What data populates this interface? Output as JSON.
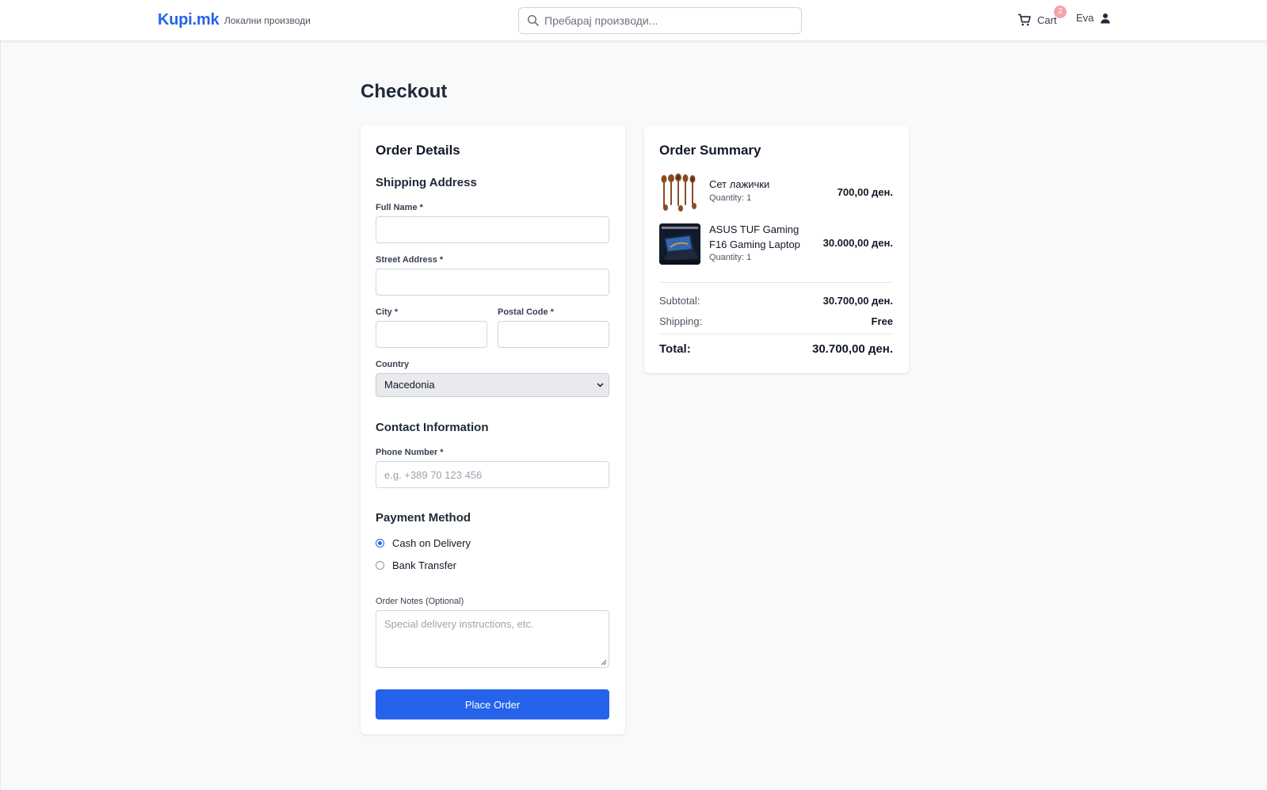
{
  "header": {
    "logo": "Kupi.mk",
    "tagline": "Локални производи",
    "search_placeholder": "Пребарај производи...",
    "cart_label": "Cart",
    "cart_count": "2",
    "user_name": "Eva"
  },
  "page": {
    "title": "Checkout"
  },
  "order_details": {
    "title": "Order Details",
    "shipping": {
      "title": "Shipping Address",
      "full_name_label": "Full Name *",
      "full_name_value": "",
      "street_label": "Street Address *",
      "street_value": "",
      "city_label": "City *",
      "city_value": "",
      "postal_label": "Postal Code *",
      "postal_value": "",
      "country_label": "Country",
      "country_value": "Macedonia"
    },
    "contact": {
      "title": "Contact Information",
      "phone_label": "Phone Number *",
      "phone_placeholder": "e.g. +389 70 123 456"
    },
    "payment": {
      "title": "Payment Method",
      "options": [
        {
          "label": "Cash on Delivery",
          "selected": true
        },
        {
          "label": "Bank Transfer",
          "selected": false
        }
      ]
    },
    "notes": {
      "label": "Order Notes (Optional)",
      "placeholder": "Special delivery instructions, etc."
    },
    "submit_label": "Place Order"
  },
  "order_summary": {
    "title": "Order Summary",
    "items": [
      {
        "name": "Сет лажички",
        "quantity": "Quantity: 1",
        "price": "700,00 ден.",
        "thumb": "wooden-spoons"
      },
      {
        "name": "ASUS TUF Gaming F16 Gaming Laptop",
        "quantity": "Quantity: 1",
        "price": "30.000,00 ден.",
        "thumb": "laptop"
      }
    ],
    "subtotal_label": "Subtotal:",
    "subtotal_value": "30.700,00 ден.",
    "shipping_label": "Shipping:",
    "shipping_value": "Free",
    "total_label": "Total:",
    "total_value": "30.700,00 ден."
  },
  "colors": {
    "brand": "#2563eb",
    "page_bg": "#f8f9fb",
    "badge": "#f5a3a3"
  }
}
